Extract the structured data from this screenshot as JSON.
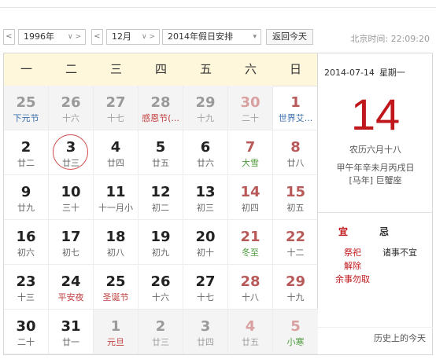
{
  "toolbar": {
    "prev": "<",
    "next": ">",
    "year_value": "1996年",
    "month_value": "12月",
    "holiday_value": "2014年假日安排",
    "today_button": "返回今天",
    "clock_label": "北京时间:",
    "clock_time": "22:09:20"
  },
  "weekdays": [
    "一",
    "二",
    "三",
    "四",
    "五",
    "六",
    "日"
  ],
  "days": [
    {
      "d": "25",
      "s": "下元节"
    },
    {
      "d": "26",
      "s": "十六"
    },
    {
      "d": "27",
      "s": "十七"
    },
    {
      "d": "28",
      "s": "感恩节(..."
    },
    {
      "d": "29",
      "s": "十九"
    },
    {
      "d": "30",
      "s": "二十"
    },
    {
      "d": "1",
      "s": "世界艾..."
    },
    {
      "d": "2",
      "s": "廿二"
    },
    {
      "d": "3",
      "s": "廿三"
    },
    {
      "d": "4",
      "s": "廿四"
    },
    {
      "d": "5",
      "s": "廿五"
    },
    {
      "d": "6",
      "s": "廿六"
    },
    {
      "d": "7",
      "s": "大雪"
    },
    {
      "d": "8",
      "s": "廿八"
    },
    {
      "d": "9",
      "s": "廿九"
    },
    {
      "d": "10",
      "s": "三十"
    },
    {
      "d": "11",
      "s": "十一月小"
    },
    {
      "d": "12",
      "s": "初二"
    },
    {
      "d": "13",
      "s": "初三"
    },
    {
      "d": "14",
      "s": "初四"
    },
    {
      "d": "15",
      "s": "初五"
    },
    {
      "d": "16",
      "s": "初六"
    },
    {
      "d": "17",
      "s": "初七"
    },
    {
      "d": "18",
      "s": "初八"
    },
    {
      "d": "19",
      "s": "初九"
    },
    {
      "d": "20",
      "s": "初十"
    },
    {
      "d": "21",
      "s": "冬至"
    },
    {
      "d": "22",
      "s": "十二"
    },
    {
      "d": "23",
      "s": "十三"
    },
    {
      "d": "24",
      "s": "平安夜"
    },
    {
      "d": "25",
      "s": "圣诞节"
    },
    {
      "d": "26",
      "s": "十六"
    },
    {
      "d": "27",
      "s": "十七"
    },
    {
      "d": "28",
      "s": "十八"
    },
    {
      "d": "29",
      "s": "十九"
    },
    {
      "d": "30",
      "s": "二十"
    },
    {
      "d": "31",
      "s": "廿一"
    },
    {
      "d": "1",
      "s": "元旦"
    },
    {
      "d": "2",
      "s": "廿三"
    },
    {
      "d": "3",
      "s": "廿四"
    },
    {
      "d": "4",
      "s": "廿五"
    },
    {
      "d": "5",
      "s": "小寒"
    }
  ],
  "side": {
    "date": "2014-07-14",
    "weekday": "星期一",
    "day": "14",
    "lunar": "农历六月十八",
    "ganzhi": "甲午年辛未月丙戌日",
    "zodiac": "[马年] 巨蟹座",
    "yi_label": "宜",
    "ji_label": "忌",
    "yi_items": [
      "祭祀",
      "解除",
      "余事勿取"
    ],
    "ji_items": [
      "诸事不宜"
    ],
    "history_link": "历史上的今天"
  },
  "colors": {
    "accent_red": "#c0171c",
    "header_bg": "#fff7dc",
    "other_month_bg": "#f4f4f4"
  }
}
